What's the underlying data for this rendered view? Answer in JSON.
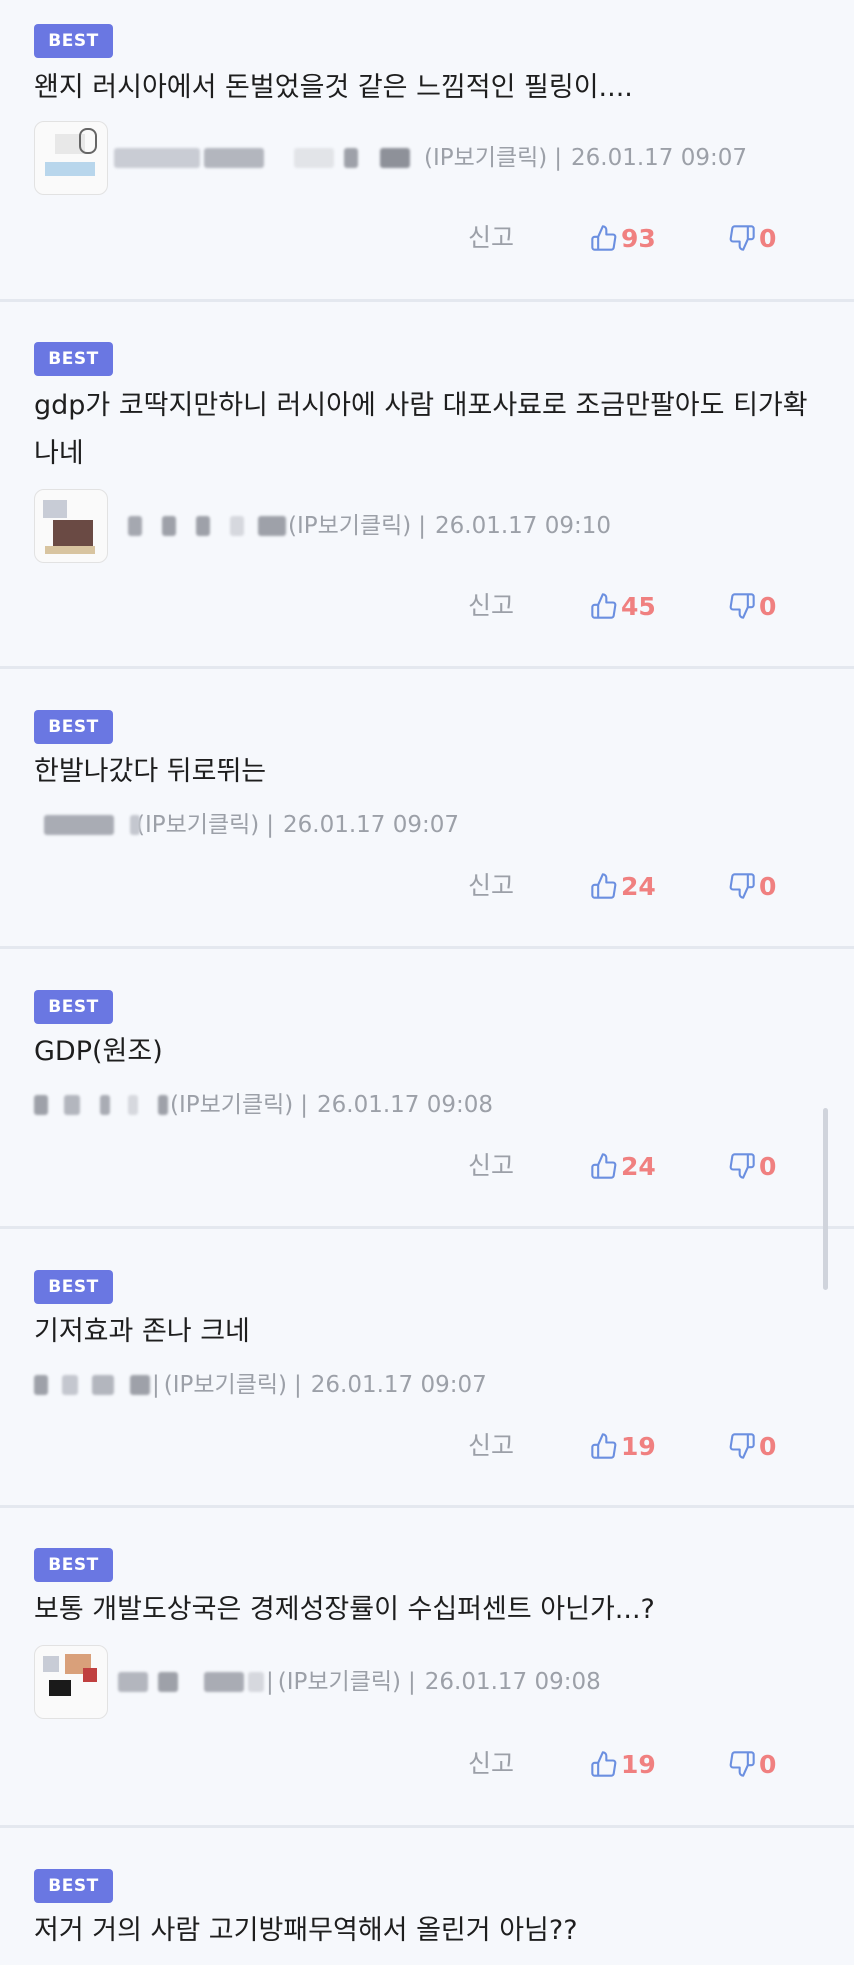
{
  "badge_label": "BEST",
  "report_label": "신고",
  "ip_label": "(IP보기클릭)",
  "separator": "|",
  "colors": {
    "badge": "#6a77e2",
    "count": "#f08080",
    "like_icon": "#6b8fe0",
    "dislike_icon": "#6b8fe0",
    "meta_text": "#9ca0a8",
    "background": "#f6f8fc"
  },
  "comments": [
    {
      "text": "왠지 러시아에서 돈벌었을것 같은 느낌적인 필링이....",
      "timestamp": "26.01.17 09:07",
      "likes": "93",
      "dislikes": "0",
      "has_avatar": true
    },
    {
      "text": "gdp가 코딱지만하니 러시아에 사람 대포사료로 조금만팔아도 티가확나네",
      "timestamp": "26.01.17 09:10",
      "likes": "45",
      "dislikes": "0",
      "has_avatar": true
    },
    {
      "text": "한발나갔다 뒤로뛰는",
      "timestamp": "26.01.17 09:07",
      "likes": "24",
      "dislikes": "0",
      "has_avatar": false
    },
    {
      "text": "GDP(원조)",
      "timestamp": "26.01.17 09:08",
      "likes": "24",
      "dislikes": "0",
      "has_avatar": false
    },
    {
      "text": "기저효과 존나 크네",
      "timestamp": "26.01.17 09:07",
      "likes": "19",
      "dislikes": "0",
      "has_avatar": false
    },
    {
      "text": "보통 개발도상국은 경제성장률이 수십퍼센트 아닌가...?",
      "timestamp": "26.01.17 09:08",
      "likes": "19",
      "dislikes": "0",
      "has_avatar": true
    },
    {
      "text": "저거 거의 사람 고기방패무역해서 올린거 아님??",
      "timestamp": "",
      "likes": "",
      "dislikes": "",
      "has_avatar": false
    }
  ]
}
